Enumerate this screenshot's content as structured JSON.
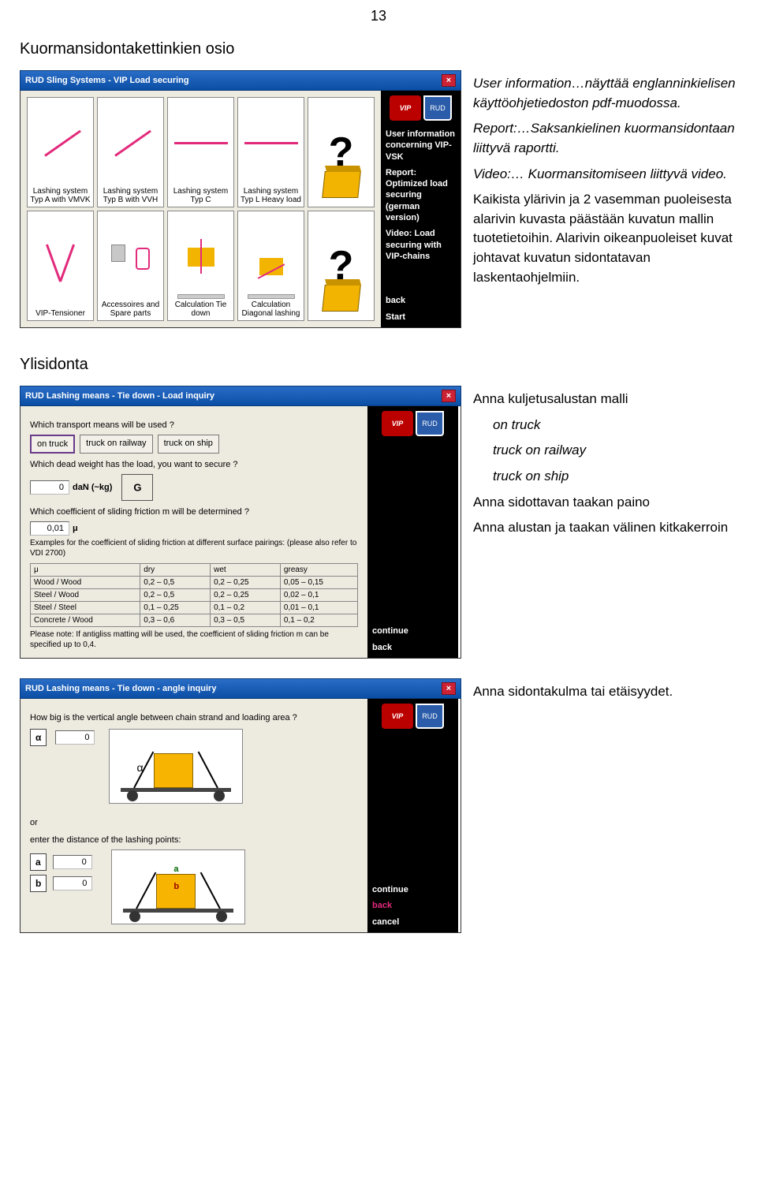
{
  "page_number": "13",
  "section_title": "Kuormansidontakettinkien osio",
  "screenshot1": {
    "title": "RUD Sling Systems - VIP Load securing",
    "sidebar": {
      "logo_red": "VIP",
      "logo_blue": "RUD",
      "user_info": "User information concerning VIP-VSK",
      "report": "Report: Optimized load securing (german version)",
      "video": "Video: Load securing with VIP-chains",
      "back": "back",
      "start": "Start"
    },
    "cells": {
      "c11": "Lashing system Typ A with VMVK",
      "c12": "Lashing system Typ B with VVH",
      "c13": "Lashing system Typ C",
      "c14": "Lashing system Typ L Heavy load",
      "c21": "VIP-Tensioner",
      "c22": "Accessoires and Spare parts",
      "c23": "Calculation Tie down",
      "c24": "Calculation Diagonal lashing"
    }
  },
  "text1": {
    "p1a": "User information…näyttää englanninkielisen käyttöohjetiedoston pdf-muodossa.",
    "p1b": "Report:…Saksankielinen kuormansidontaan liittyvä raportti.",
    "p1c": "Video:… Kuormansitomiseen liittyvä video.",
    "p2": "Kaikista ylärivin ja 2 vasemman puoleisesta alarivin kuvasta päästään kuvatun mallin tuotetietoihin. Alarivin oikeanpuoleiset kuvat johtavat kuvatun sidontatavan laskentaohjelmiin."
  },
  "section2_title": "Ylisidonta",
  "screenshot2": {
    "title": "RUD Lashing means - Tie down - Load inquiry",
    "sidebar_continue": "continue",
    "sidebar_back": "back",
    "q1": "Which transport means will be used ?",
    "btn1": "on truck",
    "btn2": "truck on railway",
    "btn3": "truck on ship",
    "q2": "Which dead weight has the load, you want to secure ?",
    "f2_val": "0",
    "f2_unit": "daN (~kg)",
    "q3": "Which coefficient of sliding friction m will be determined ?",
    "f3_val": "0,01",
    "f3_unit": "μ",
    "tbl_title": "Examples for the coefficient of sliding friction at different surface pairings: (please also refer to VDI 2700)",
    "tbl": {
      "h0": "μ",
      "h1": "dry",
      "h2": "wet",
      "h3": "greasy",
      "r": [
        [
          "Wood / Wood",
          "0,2 – 0,5",
          "0,2 – 0,25",
          "0,05 – 0,15"
        ],
        [
          "Steel / Wood",
          "0,2 – 0,5",
          "0,2 – 0,25",
          "0,02 – 0,1"
        ],
        [
          "Steel / Steel",
          "0,1 – 0,25",
          "0,1 – 0,2",
          "0,01 – 0,1"
        ],
        [
          "Concrete / Wood",
          "0,3 – 0,6",
          "0,3 – 0,5",
          "0,1 – 0,2"
        ]
      ]
    },
    "footnote": "Please note: If antigliss matting will be used, the coefficient of sliding friction m can be specified up to 0,4."
  },
  "text2": {
    "p1": "Anna kuljetusalustan malli",
    "l1": "on truck",
    "l2": "truck on railway",
    "l3": "truck on ship",
    "p2": "Anna sidottavan taakan paino",
    "p3": "Anna alustan ja taakan välinen kitkakerroin"
  },
  "screenshot3": {
    "title": "RUD Lashing means - Tie down - angle inquiry",
    "q1": "How big is the vertical angle between chain strand and loading area ?",
    "alpha_sym": "α",
    "alpha_val": "0",
    "or": "or",
    "q2": "enter the distance of the lashing points:",
    "a_lbl": "a",
    "a_val": "0",
    "b_lbl": "b",
    "b_val": "0",
    "sb_continue": "continue",
    "sb_back": "back",
    "sb_cancel": "cancel",
    "diag_a": "a",
    "diag_b": "b"
  },
  "text3": "Anna sidontakulma tai etäisyydet."
}
